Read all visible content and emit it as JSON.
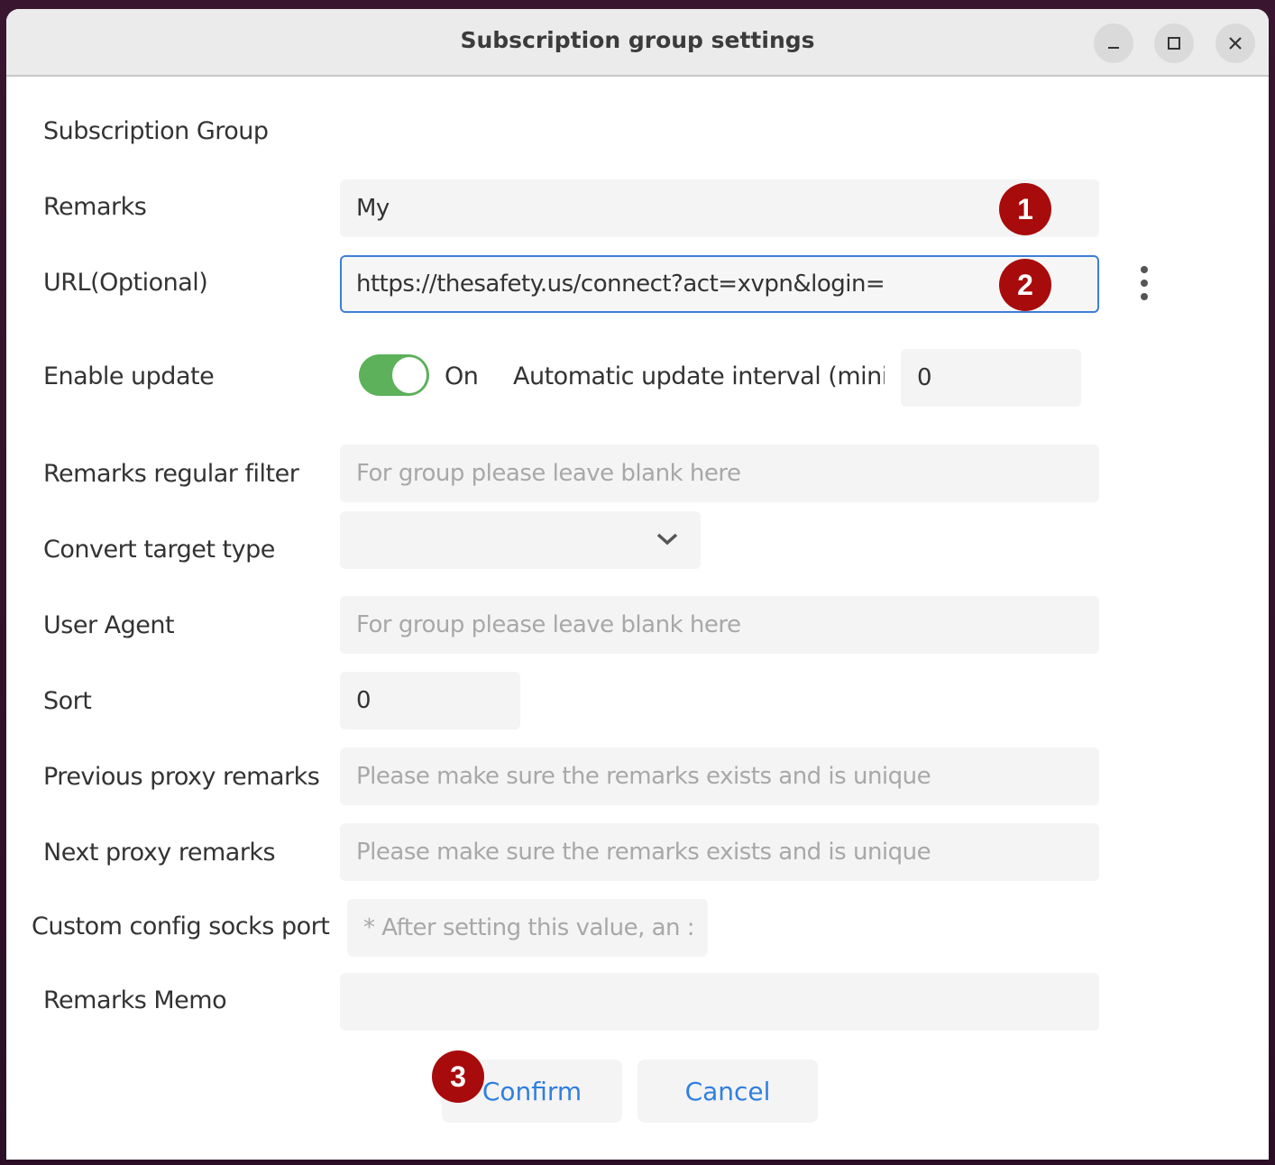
{
  "window": {
    "title": "Subscription group settings",
    "controls": [
      "minimize",
      "maximize",
      "close"
    ]
  },
  "form": {
    "section_title": "Subscription Group",
    "remarks": {
      "label": "Remarks",
      "value": "My"
    },
    "url": {
      "label": "URL(Optional)",
      "value": "https://thesafety.us/connect?act=xvpn&login="
    },
    "enable_update": {
      "label": "Enable update",
      "toggle_state": "On",
      "enabled": true
    },
    "update_interval": {
      "label": "Automatic update interval (mini",
      "value": "0"
    },
    "remarks_filter": {
      "label": "Remarks regular filter",
      "placeholder": "For group please leave blank here",
      "value": ""
    },
    "convert_target": {
      "label": "Convert target type",
      "value": ""
    },
    "user_agent": {
      "label": "User Agent",
      "placeholder": "For group please leave blank here",
      "value": ""
    },
    "sort": {
      "label": "Sort",
      "value": "0"
    },
    "prev_proxy": {
      "label": "Previous proxy remarks",
      "placeholder": "Please make sure the remarks exists and is unique",
      "value": ""
    },
    "next_proxy": {
      "label": "Next proxy remarks",
      "placeholder": "Please make sure the remarks exists and is unique",
      "value": ""
    },
    "socks_port": {
      "label": "Custom config socks port",
      "placeholder": "* After setting this value, an :",
      "value": ""
    },
    "memo": {
      "label": "Remarks Memo",
      "value": ""
    }
  },
  "buttons": {
    "confirm": "Confirm",
    "cancel": "Cancel"
  },
  "annotations": {
    "badge1": "1",
    "badge2": "2",
    "badge3": "3"
  },
  "colors": {
    "accent": "#3d7fd6",
    "button_text": "#2f7fe0",
    "toggle_on": "#5cb15a",
    "badge": "#a80b0b"
  }
}
